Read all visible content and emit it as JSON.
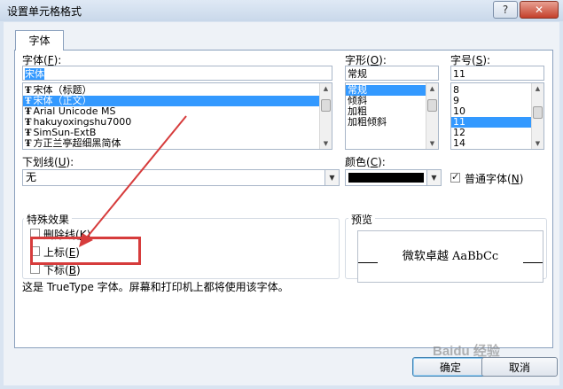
{
  "window": {
    "title": "设置单元格格式",
    "help_label": "?",
    "close_label": "✕"
  },
  "tabs": [
    {
      "label": "字体"
    }
  ],
  "font": {
    "label": "字体",
    "hotkey": "F",
    "value": "宋体",
    "tt_glyph": "Ŧ",
    "items": [
      {
        "label": "宋体（标题）",
        "selected": false
      },
      {
        "label": "宋体（正文）",
        "selected": true
      },
      {
        "label": "Arial Unicode MS",
        "selected": false
      },
      {
        "label": "hakuyoxingshu7000",
        "selected": false
      },
      {
        "label": "SimSun-ExtB",
        "selected": false
      },
      {
        "label": "方正兰亭超细黑简体",
        "selected": false
      }
    ]
  },
  "style": {
    "label": "字形",
    "hotkey": "O",
    "value": "常规",
    "items": [
      {
        "label": "常规",
        "selected": true
      },
      {
        "label": "倾斜",
        "selected": false
      },
      {
        "label": "加粗",
        "selected": false
      },
      {
        "label": "加粗倾斜",
        "selected": false
      }
    ]
  },
  "size": {
    "label": "字号",
    "hotkey": "S",
    "value": "11",
    "items": [
      {
        "label": "8",
        "selected": false
      },
      {
        "label": "9",
        "selected": false
      },
      {
        "label": "10",
        "selected": false
      },
      {
        "label": "11",
        "selected": true
      },
      {
        "label": "12",
        "selected": false
      },
      {
        "label": "14",
        "selected": false
      }
    ]
  },
  "underline": {
    "label": "下划线",
    "hotkey": "U",
    "value": "无"
  },
  "color": {
    "label": "颜色",
    "hotkey": "C",
    "swatch": "#000000"
  },
  "normal_font": {
    "label": "普通字体",
    "hotkey": "N",
    "checked": true
  },
  "effects": {
    "title": "特殊效果",
    "strikethrough": {
      "label": "删除线",
      "hotkey": "K",
      "checked": false
    },
    "superscript": {
      "label": "上标",
      "hotkey": "E",
      "checked": false
    },
    "subscript": {
      "label": "下标",
      "hotkey": "B",
      "checked": false
    }
  },
  "preview": {
    "title": "预览",
    "sample": "微软卓越  AaBbCc"
  },
  "note": "这是 TrueType 字体。屏幕和打印机上都将使用该字体。",
  "buttons": {
    "ok": "确定",
    "cancel": "取消"
  },
  "watermark": "Baidu 经验",
  "annotation_color": "#d63c3c"
}
